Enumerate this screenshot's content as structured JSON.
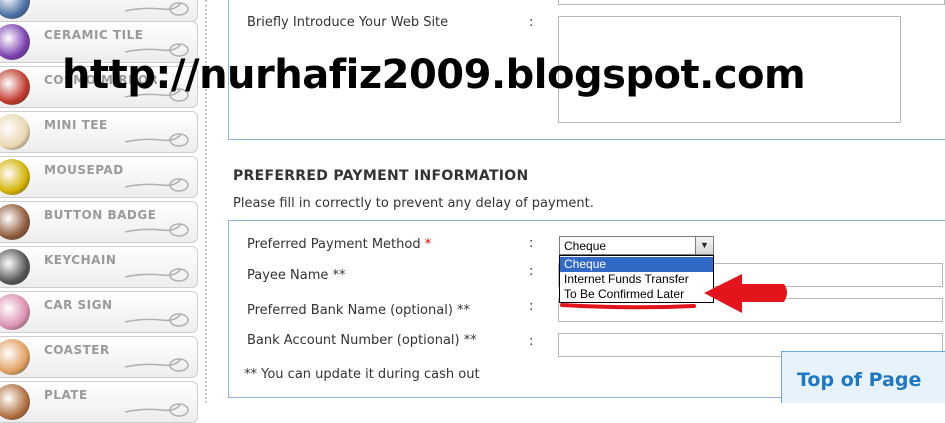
{
  "sidebar": {
    "items": [
      {
        "label": "",
        "thumb_color": "#4a6fa5"
      },
      {
        "label": "CERAMIC TILE",
        "thumb_color": "#7a3fb0"
      },
      {
        "label": "COSMO MIRROR",
        "thumb_color": "#c0392b"
      },
      {
        "label": "MINI TEE",
        "thumb_color": "#e8d8b0"
      },
      {
        "label": "MOUSEPAD",
        "thumb_color": "#d4b200"
      },
      {
        "label": "BUTTON BADGE",
        "thumb_color": "#8e5b3b"
      },
      {
        "label": "KEYCHAIN",
        "thumb_color": "#555555"
      },
      {
        "label": "CAR SIGN",
        "thumb_color": "#d98fb0"
      },
      {
        "label": "COASTER",
        "thumb_color": "#e0a060"
      },
      {
        "label": "PLATE",
        "thumb_color": "#b07040"
      }
    ]
  },
  "watermark": "http://nurhafiz2009.blogspot.com",
  "site_section": {
    "intro_label": "Briefly Introduce Your Web Site",
    "colon": ":"
  },
  "payment": {
    "title": "PREFERRED PAYMENT INFORMATION",
    "subtitle": "Please fill in correctly to prevent any delay of payment.",
    "method_label": "Preferred Payment Method",
    "required_mark": "*",
    "method_value": "Cheque",
    "method_options": [
      "Cheque",
      "Internet Funds Transfer",
      "To Be Confirmed Later"
    ],
    "payee_label": "Payee Name **",
    "bank_label": "Preferred Bank Name (optional) **",
    "account_label": "Bank Account Number (optional) **",
    "footnote": "** You can update it during cash out",
    "colon": ":"
  },
  "top_of_page": "Top of Page",
  "colors": {
    "box_border": "#8fb3d9",
    "dropdown_highlight": "#3169c6",
    "arrow_red": "#e3141b",
    "top_btn_text": "#1f78c1"
  }
}
